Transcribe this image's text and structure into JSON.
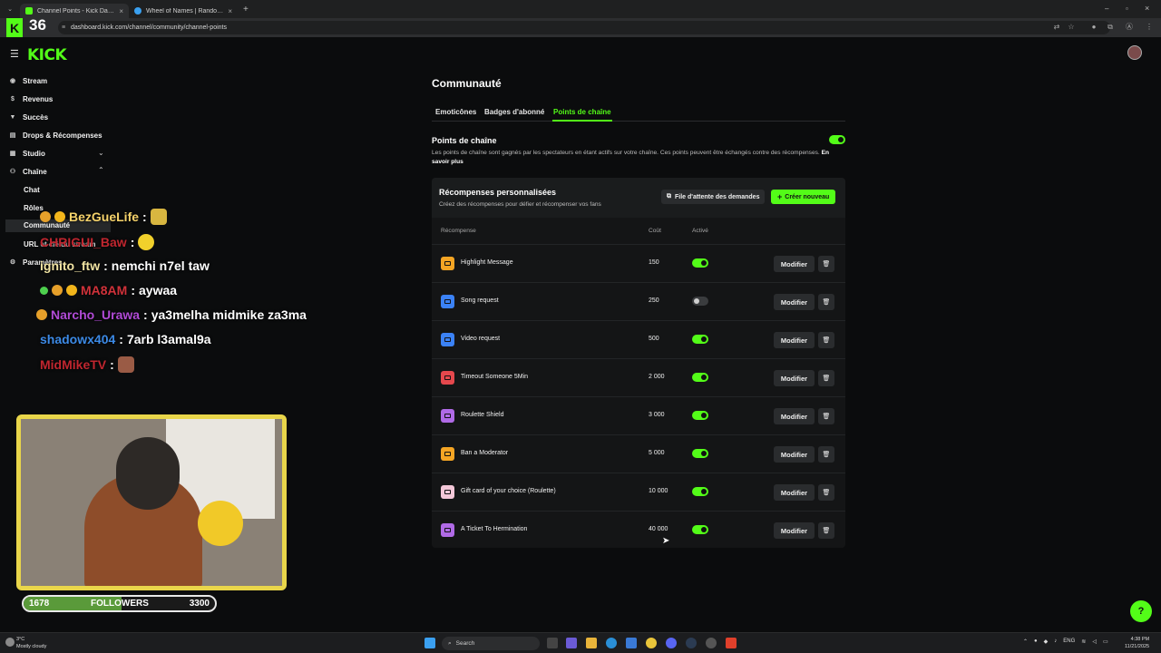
{
  "browser": {
    "tabs": [
      {
        "title": "Channel Points - Kick Dashboard",
        "active": true
      },
      {
        "title": "Wheel of Names | Random name",
        "active": false
      }
    ],
    "url": "dashboard.kick.com/channel/community/channel-points",
    "tab_counter": "36"
  },
  "brand": {
    "logo": "KICK",
    "accent": "#53fc18"
  },
  "sidebar": {
    "items": [
      {
        "label": "Stream",
        "icon": "broadcast-icon"
      },
      {
        "label": "Revenus",
        "icon": "dollar-icon"
      },
      {
        "label": "Succès",
        "icon": "trophy-icon"
      },
      {
        "label": "Drops & Récompenses",
        "icon": "gift-icon"
      },
      {
        "label": "Studio",
        "icon": "studio-icon"
      },
      {
        "label": "Chaîne",
        "icon": "channel-icon"
      }
    ],
    "sub_items": [
      "Chat",
      "Rôles",
      "Communauté",
      "URL et clé du stream"
    ],
    "settings_label": "Paramètres"
  },
  "chat_overlay": [
    {
      "user": "BezGueLife",
      "color": "#f6d36b",
      "message": ""
    },
    {
      "user": "CHRIGUI_Baw",
      "color": "#c0262f",
      "message": ""
    },
    {
      "user": "ignito_ftw",
      "color": "#f1e4a3",
      "message": "nemchi n7el taw"
    },
    {
      "user": "MA8AM",
      "color": "#d0323a",
      "message": "aywaa"
    },
    {
      "user": "Narcho_Urawa",
      "color": "#b14bd6",
      "message": "ya3melha midmike za3ma"
    },
    {
      "user": "shadowx404",
      "color": "#3c8ae6",
      "message": "7arb l3amal9a"
    },
    {
      "user": "MidMikeTV",
      "color": "#c0262f",
      "message": ""
    }
  ],
  "followers_bar": {
    "current": "1678",
    "label": "FOLLOWERS",
    "goal": "3300",
    "progress": 0.51
  },
  "page": {
    "title": "Communauté",
    "tabs": [
      "Emoticônes",
      "Badges d'abonné",
      "Points de chaîne"
    ],
    "active_tab": "Points de chaîne",
    "channel_points": {
      "title": "Points de chaîne",
      "description": "Les points de chaîne sont gagnés par les spectateurs en étant actifs sur votre chaîne. Ces points peuvent être échangés contre des récompenses.",
      "learn_more": "En savoir plus",
      "enabled": true
    },
    "rewards_panel": {
      "title": "Récompenses personnalisées",
      "subtitle": "Créez des récompenses pour défier et récompenser vos fans",
      "queue_button": "File d'attente des demandes",
      "create_button": "Créer nouveau",
      "columns": {
        "reward": "Récompense",
        "cost": "Coût",
        "active": "Activé"
      },
      "edit_label": "Modifier",
      "rewards": [
        {
          "name": "Highlight Message",
          "cost": "150",
          "active": true,
          "color": "#f5a524"
        },
        {
          "name": "Song request",
          "cost": "250",
          "active": false,
          "color": "#3b82f6"
        },
        {
          "name": "Video request",
          "cost": "500",
          "active": true,
          "color": "#3b82f6"
        },
        {
          "name": "Timeout Someone 5Min",
          "cost": "2 000",
          "active": true,
          "color": "#e5484d"
        },
        {
          "name": "Roulette Shield",
          "cost": "3 000",
          "active": true,
          "color": "#b06ae6"
        },
        {
          "name": "Ban a Moderator",
          "cost": "5 000",
          "active": true,
          "color": "#f5a524"
        },
        {
          "name": "Gift card of your choice (Roulette)",
          "cost": "10 000",
          "active": true,
          "color": "#f3c7d8"
        },
        {
          "name": "A Ticket To Hermination",
          "cost": "40 000",
          "active": true,
          "color": "#b06ae6"
        }
      ]
    }
  },
  "taskbar": {
    "weather_temp": "3°C",
    "weather_desc": "Mostly cloudy",
    "search_placeholder": "Search",
    "language": "ENG",
    "time": "4:38 PM",
    "date": "11/21/2025"
  }
}
